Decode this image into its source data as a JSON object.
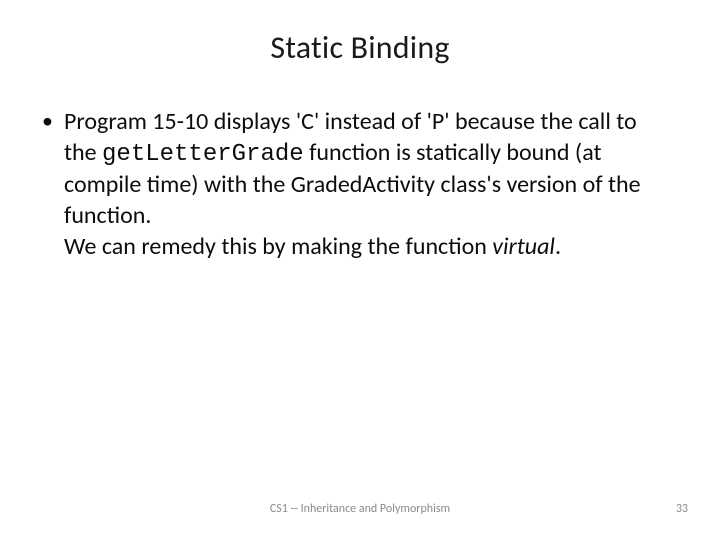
{
  "title": "Static Binding",
  "bullet": {
    "part1": "Program 15-10 displays 'C' instead of 'P' because the call to the ",
    "code": "getLetterGrade",
    "part2": " function is statically bound (at compile time) with the GradedActivity class's version of the function.",
    "part3a": "We can remedy this by making the function ",
    "part3b": "virtual",
    "part3c": "."
  },
  "footer": "CS1 -- Inheritance and Polymorphism",
  "page_number": "33"
}
